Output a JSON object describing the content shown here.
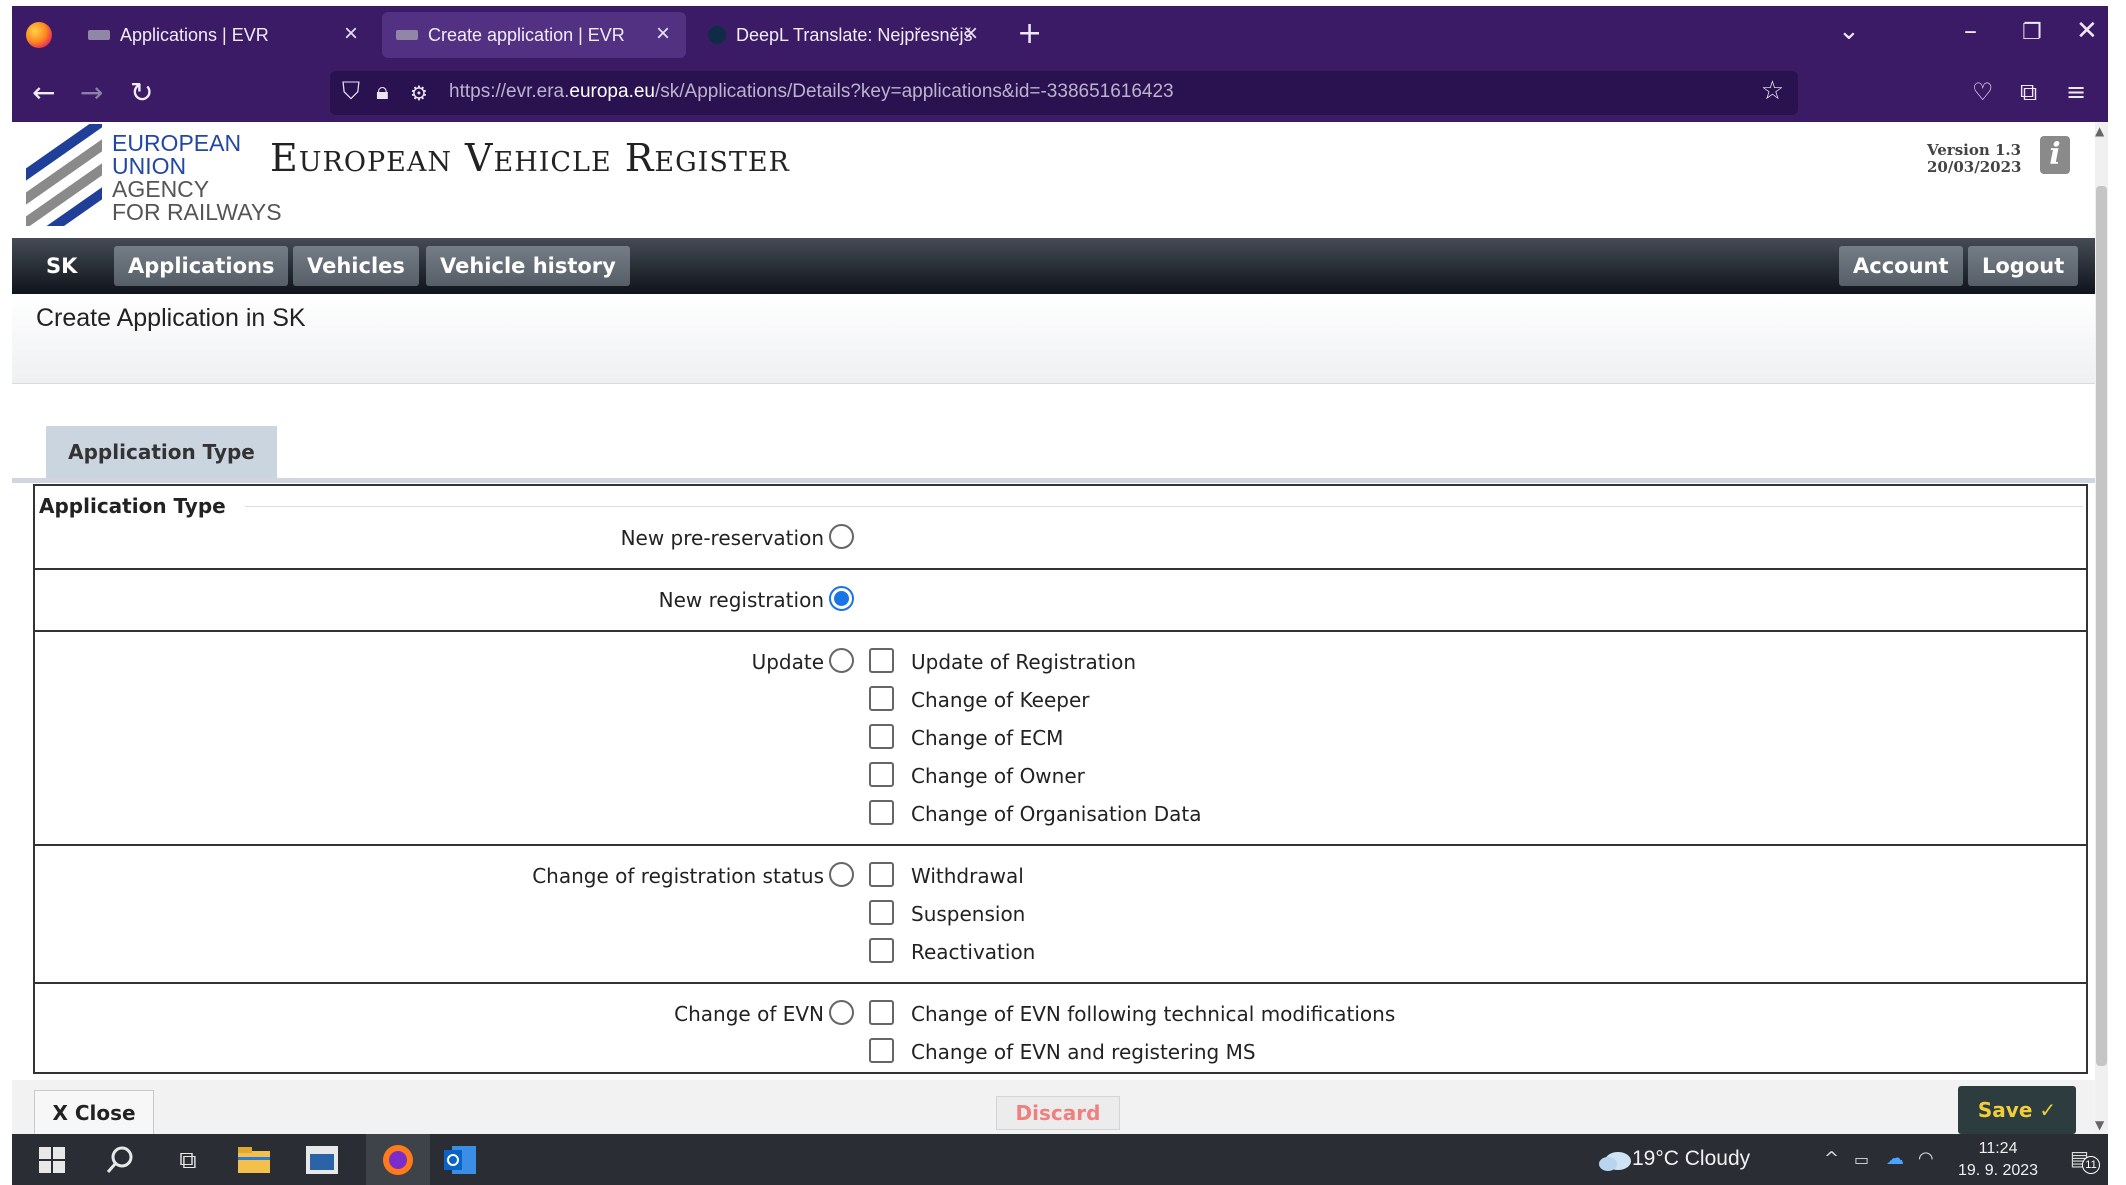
{
  "browser": {
    "tabs": [
      {
        "title": "Applications | EVR",
        "active": false
      },
      {
        "title": "Create application | EVR",
        "active": true
      },
      {
        "title": "DeepL Translate: Nejpřesnější p",
        "active": false
      }
    ],
    "url_prefix": "https://evr.era.",
    "url_domain": "europa.eu",
    "url_path": "/sk/Applications/Details?key=applications&id=-338651616423"
  },
  "header": {
    "logo_lines": [
      "EUROPEAN",
      "UNION",
      "AGENCY",
      "FOR RAILWAYS"
    ],
    "title": "European Vehicle Register",
    "version": "Version 1.3",
    "version_date": "20/03/2023"
  },
  "menu": {
    "country": "SK",
    "applications": "Applications",
    "vehicles": "Vehicles",
    "vehicle_history": "Vehicle history",
    "account": "Account",
    "logout": "Logout"
  },
  "page": {
    "title": "Create Application in SK",
    "tab": "Application Type"
  },
  "form": {
    "legend": "Application Type",
    "options": {
      "pre_reservation": {
        "label": "New pre-reservation",
        "checked": false
      },
      "registration": {
        "label": "New registration",
        "checked": true
      },
      "update": {
        "label": "Update",
        "checked": false,
        "sub": [
          "Update of Registration",
          "Change of Keeper",
          "Change of ECM",
          "Change of Owner",
          "Change of Organisation Data"
        ]
      },
      "status": {
        "label": "Change of registration status",
        "checked": false,
        "sub": [
          "Withdrawal",
          "Suspension",
          "Reactivation"
        ]
      },
      "evn": {
        "label": "Change of EVN",
        "checked": false,
        "sub": [
          "Change of EVN following technical modifications",
          "Change of EVN and registering MS"
        ]
      }
    }
  },
  "footer": {
    "close": "X Close",
    "discard": "Discard",
    "save": "Save ✓"
  },
  "taskbar": {
    "weather": "19°C  Cloudy",
    "time": "11:24",
    "date": "19. 9. 2023",
    "notif_count": "11"
  },
  "colors": {
    "browser_chrome": "#3b1b66",
    "menu_dark": "#0f141b",
    "save_text": "#f2cf3a",
    "discard_text": "#f08080",
    "radio_checked": "#1a73e8"
  }
}
